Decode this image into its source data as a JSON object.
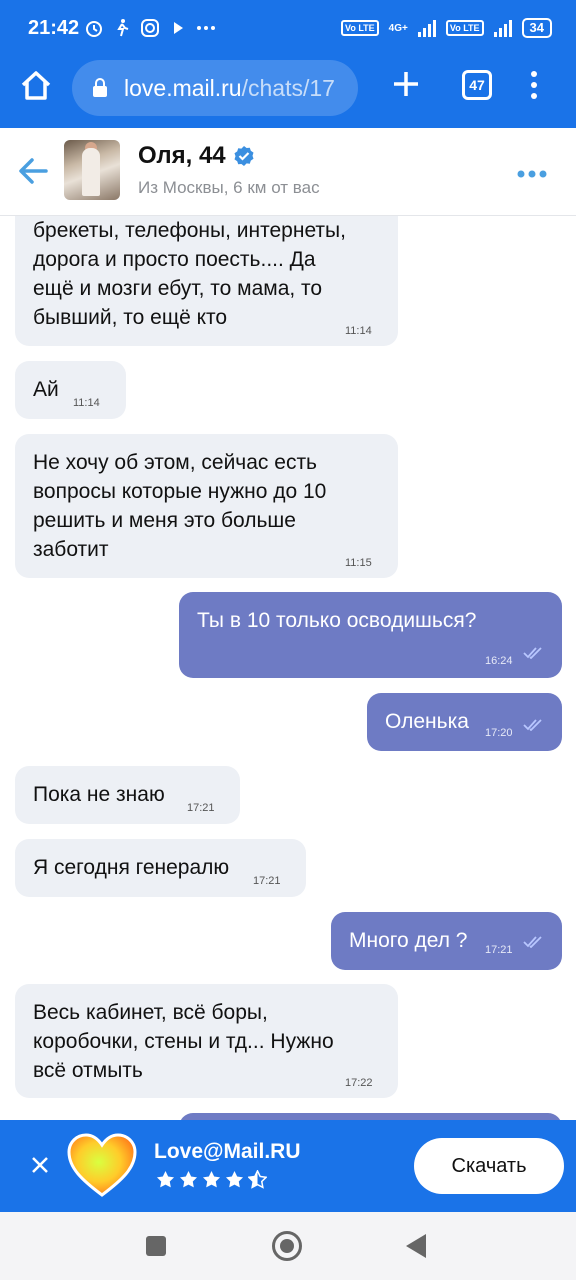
{
  "status_bar": {
    "time": "21:42",
    "network_label": "4G+",
    "lte_label": "Vo LTE",
    "battery": "34"
  },
  "browser": {
    "url_domain": "love.mail.ru",
    "url_path": "/chats/17",
    "tab_count": "47"
  },
  "chat_header": {
    "name": "Оля, 44",
    "location": "Из Москвы, 6 км от вас"
  },
  "messages": [
    {
      "dir": "in",
      "text_lines": [
        "брекеты, телефоны, интернеты,",
        "дорога и просто поесть.... Да",
        "ещё и мозги ебут, то мама, то",
        "бывший, то ещё кто"
      ],
      "time": "11:14"
    },
    {
      "dir": "in",
      "text_lines": [
        "Ай"
      ],
      "time": "11:14"
    },
    {
      "dir": "in",
      "text_lines": [
        "Не хочу об этом, сейчас есть",
        "вопросы которые нужно до 10",
        "решить и меня это больше",
        "заботит"
      ],
      "time": "11:15"
    },
    {
      "dir": "out",
      "text_lines": [
        "Ты в 10 только осводишься?"
      ],
      "time": "16:24"
    },
    {
      "dir": "out",
      "text_lines": [
        "Оленька"
      ],
      "time": "17:20"
    },
    {
      "dir": "in",
      "text_lines": [
        "Пока не знаю"
      ],
      "time": "17:21"
    },
    {
      "dir": "in",
      "text_lines": [
        "Я сегодня генералю"
      ],
      "time": "17:21"
    },
    {
      "dir": "out",
      "text_lines": [
        "Много дел ?"
      ],
      "time": "17:21"
    },
    {
      "dir": "in",
      "text_lines": [
        "Весь кабинет, всё боры,",
        "коробочки, стены и тд... Нужно",
        "всё отмыть"
      ],
      "time": "17:22"
    }
  ],
  "banner": {
    "app_name": "Love@Mail.RU",
    "rating": 4.5,
    "download_label": "Скачать"
  },
  "colors": {
    "brand_blue": "#1a73e8",
    "outgoing_bubble": "#6e7bc4",
    "incoming_bubble": "#edf0f5"
  }
}
